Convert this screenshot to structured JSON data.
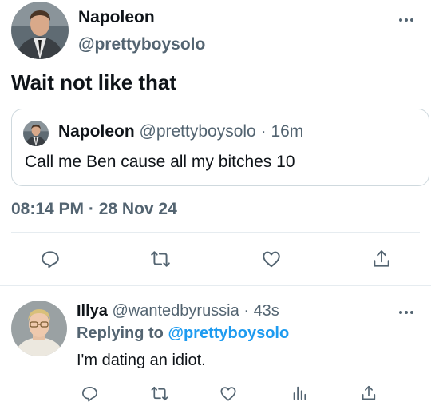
{
  "main_tweet": {
    "display_name": "Napoleon",
    "handle": "@prettyboysolo",
    "text": "Wait not like that",
    "quote": {
      "display_name": "Napoleon",
      "handle": "@prettyboysolo",
      "separator": "·",
      "age": "16m",
      "text": "Call me Ben cause all my bitches 10"
    },
    "time": "08:14 PM",
    "separator": "·",
    "date": "28 Nov 24",
    "actions": [
      "reply-icon",
      "retweet-icon",
      "like-icon",
      "share-icon"
    ]
  },
  "reply_tweet": {
    "display_name": "Illya",
    "handle": "@wantedbyrussia",
    "separator": "·",
    "age": "43s",
    "replying_to_label": "Replying to",
    "replying_to_handle": "@prettyboysolo",
    "text": "I'm dating an idiot.",
    "actions": [
      "reply-icon",
      "retweet-icon",
      "like-icon",
      "analytics-icon",
      "share-icon"
    ]
  },
  "colors": {
    "text_primary": "#0f1419",
    "text_secondary": "#536471",
    "link": "#1d9bf0",
    "border": "#cfd9de",
    "divider": "#e6ecf0"
  }
}
